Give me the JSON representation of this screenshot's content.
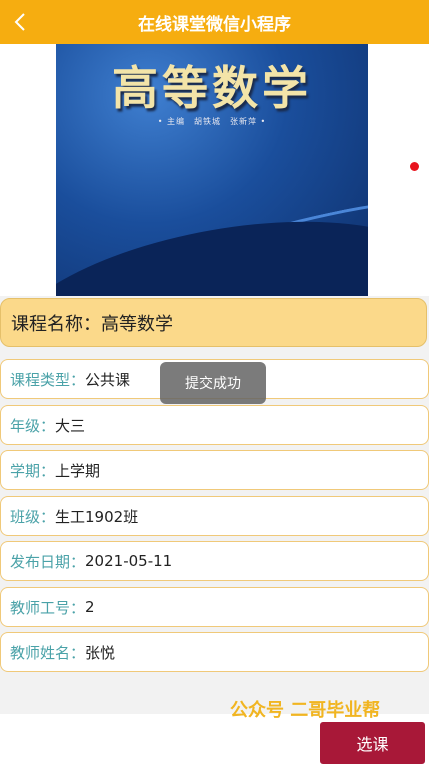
{
  "header": {
    "title": "在线课堂微信小程序"
  },
  "cover": {
    "title": "高等数学",
    "authors": "• 主编　胡铁城　张新萍 •"
  },
  "course_name": {
    "label": "课程名称：",
    "value": "高等数学"
  },
  "details": [
    {
      "label": "课程类型：",
      "value": "公共课"
    },
    {
      "label": "年级：",
      "value": "大三"
    },
    {
      "label": "学期：",
      "value": "上学期"
    },
    {
      "label": "班级：",
      "value": "生工1902班"
    },
    {
      "label": "发布日期：",
      "value": "2021-05-11"
    },
    {
      "label": "教师工号：",
      "value": "2"
    },
    {
      "label": "教师姓名：",
      "value": "张悦"
    }
  ],
  "toast": {
    "text": "提交成功"
  },
  "watermark": "公众号 二哥毕业帮",
  "actions": {
    "select_label": "选课"
  },
  "colors": {
    "header": "#f6ad10",
    "label": "#4aa2a8",
    "button": "#a81838",
    "course_bg": "#fbd98a"
  }
}
